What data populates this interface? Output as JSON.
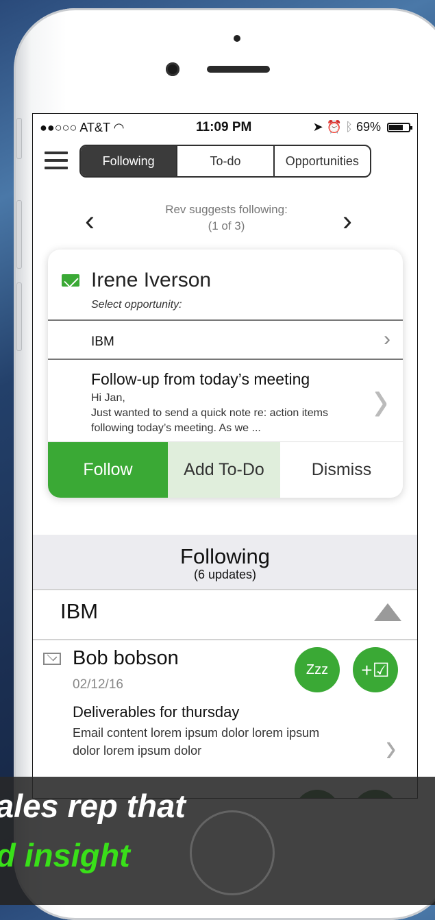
{
  "status_bar": {
    "carrier": "●●○○○ AT&T",
    "wifi_icon": "wifi-icon",
    "time": "11:09 PM",
    "battery_percent": "69%"
  },
  "tabs": [
    {
      "label": "Following",
      "selected": true
    },
    {
      "label": "To-do",
      "selected": false
    },
    {
      "label": "Opportunities",
      "selected": false
    }
  ],
  "suggestion_nav": {
    "prev_symbol": "‹",
    "next_symbol": "›",
    "title": "Rev suggests following:",
    "counter": "(1 of 3)"
  },
  "suggestion_card": {
    "contact_name": "Irene Iverson",
    "select_label": "Select opportunity:",
    "opportunity": "IBM",
    "email_subject": "Follow-up from today’s meeting",
    "email_line1": "Hi Jan,",
    "email_preview": "Just wanted to send a quick note re: action items following today’s meeting. As we ...",
    "follow_label": "Follow",
    "add_todo_label": "Add To-Do",
    "dismiss_label": "Dismiss"
  },
  "following_section": {
    "title": "Following",
    "updates": "(6 updates)",
    "group_name": "IBM",
    "items": [
      {
        "name": "Bob bobson",
        "date": "02/12/16",
        "subject": "Deliverables for thursday",
        "preview": "Email content lorem ipsum dolor lorem ipsum dolor lorem ipsum dolor",
        "snooze_label": "Zzz",
        "add_label": "+☑"
      }
    ]
  },
  "caption": {
    "line1": "ales rep that",
    "line2": "d insight"
  },
  "colors": {
    "accent_green": "#3aa935",
    "caption_green": "#39e019"
  }
}
